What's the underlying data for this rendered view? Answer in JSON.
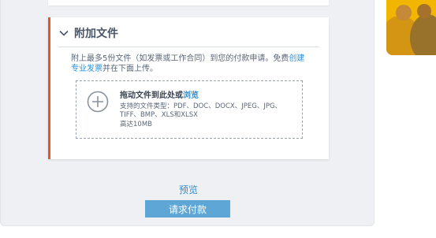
{
  "attachments": {
    "title": "附加文件",
    "description_prefix": "附上最多5份文件（如发票或工作合同）到您的付款申请。免费",
    "description_link": "创建专业发票",
    "description_suffix": "并在下面上传。",
    "dropzone": {
      "title_prefix": "拖动文件到此处或",
      "browse_link": "浏览",
      "supported_types": "支持的文件类型：PDF、DOC、DOCX、JPEG、JPG、TIFF、BMP、XLS和XLSX",
      "max_size": "高达10MB"
    }
  },
  "actions": {
    "preview_label": "预览",
    "request_payment_label": "请求付款"
  },
  "colors": {
    "accent_border": "#e8522c",
    "link": "#2d8fd5",
    "button": "#5ea6d6",
    "promo_yellow": "#f2b600"
  },
  "icons": [
    "chevron-down-icon",
    "add-circle-icon"
  ]
}
